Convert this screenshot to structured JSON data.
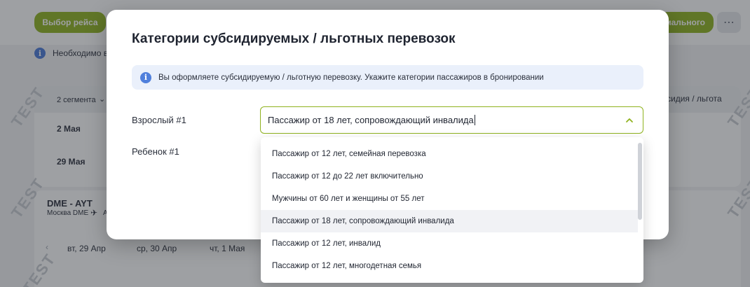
{
  "background": {
    "flight_select_label": "Выбор рейса",
    "optimal_label": "имального",
    "more_label": "⋯",
    "notice_text": "Необходимо вв",
    "segments_label": "2 сегмента",
    "subsidy_label": "сидия / льгота",
    "date_1": "2 Мая",
    "date_2": "29 Мая",
    "route_code": "DME - AYT",
    "route_city": "Москва DME",
    "route_tail": "A",
    "day_1": "вт, 29 Апр",
    "day_2": "ср, 30 Апр",
    "day_3": "чт, 1 Мая",
    "watermark": "TEST"
  },
  "modal": {
    "title": "Категории субсидируемых / льготных перевозок",
    "info_text": "Вы оформляете субсидируемую / льготную перевозку. Укажите категории пассажиров в бронировании",
    "adult_label": "Взрослый #1",
    "child_label": "Ребенок #1",
    "adult_value": "Пассажир от 18 лет, сопровождающий инвалида"
  },
  "dropdown": {
    "options": [
      "Пассажир от 12 лет, семейная перевозка",
      "Пассажир от 12 до 22 лет включительно",
      "Мужчины от 60 лет и женщины от 55 лет",
      "Пассажир от 18 лет, сопровождающий инвалида",
      "Пассажир от 12 лет, инвалид",
      "Пассажир от 12 лет, многодетная семья"
    ],
    "selected_index": 3
  },
  "colors": {
    "accent": "#8fb21e",
    "info": "#4f7fdc"
  }
}
